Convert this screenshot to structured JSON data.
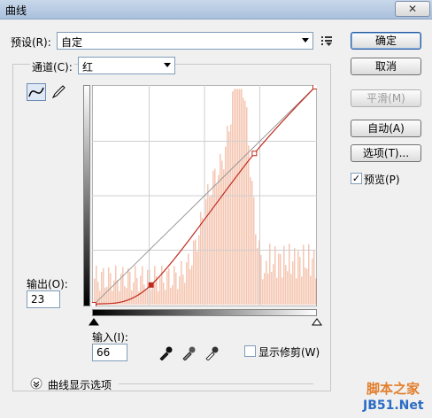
{
  "window": {
    "title": "曲线",
    "close_glyph": "✕"
  },
  "preset": {
    "label": "预设(R):",
    "value": "自定"
  },
  "channel": {
    "label": "通道(C):",
    "value": "红"
  },
  "output": {
    "label": "输出(O):",
    "value": "23"
  },
  "input": {
    "label": "输入(I):",
    "value": "66"
  },
  "buttons": {
    "ok": "确定",
    "cancel": "取消",
    "smooth": "平滑(M)",
    "auto": "自动(A)",
    "options": "选项(T)..."
  },
  "preview": {
    "label": "预览(P)",
    "checked": true
  },
  "show_clipping": {
    "label": "显示修剪(W)",
    "checked": false
  },
  "curve_display_options": {
    "label": "曲线显示选项"
  },
  "watermark": {
    "line1": "脚本之家",
    "line2": "JB51.Net"
  },
  "curve": {
    "color": "#c02a1e",
    "histogram_color": "#f5c7b3",
    "points": [
      [
        0,
        0
      ],
      [
        66,
        23
      ],
      [
        185,
        177
      ],
      [
        255,
        255
      ]
    ]
  }
}
